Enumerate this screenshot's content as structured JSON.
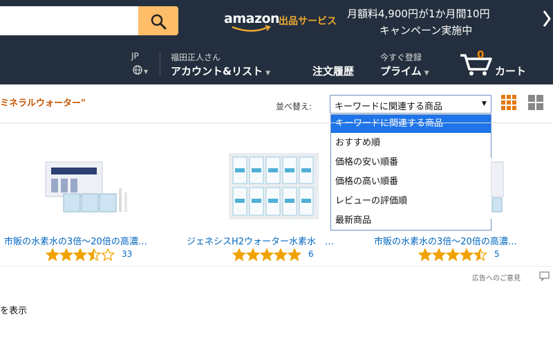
{
  "header": {
    "logo": "amazon",
    "logo_sub": "出品サービス",
    "promo_line1": "月額料4,900円が1か月間10円",
    "promo_line2": "キャンペーン実施中",
    "language": "JP",
    "greeting": "福田正人さん",
    "account_label": "アカウント&リスト",
    "orders_label": "注文履歴",
    "prime_top": "今すぐ登録",
    "prime_label": "プライム",
    "cart_count": "0",
    "cart_label": "カート"
  },
  "results": {
    "term": "ミネラルウォーター\"",
    "sort_label": "並べ替え:",
    "sort_selected": "キーワードに関連する商品",
    "sort_options": [
      "キーワードに関連する商品",
      "おすすめ順",
      "価格の安い順番",
      "価格の高い順番",
      "レビューの評価順",
      "最新商品"
    ]
  },
  "products": [
    {
      "title": "市販の水素水の3倍～20倍の高濃…",
      "rating": 3.5,
      "count": "33"
    },
    {
      "title": "ジェネシスH2ウォーター水素水　…",
      "rating": 5,
      "count": "6"
    },
    {
      "title": "市販の水素水の3倍～20倍の高濃…",
      "rating": 4.5,
      "count": "5"
    }
  ],
  "footer": {
    "ad_feedback": "広告へのご意見",
    "show_text": "を表示"
  },
  "colors": {
    "header_bg": "#232f3e",
    "accent": "#febd69",
    "link": "#0066c0",
    "star": "#f0a300",
    "selection": "#1e74e8"
  }
}
